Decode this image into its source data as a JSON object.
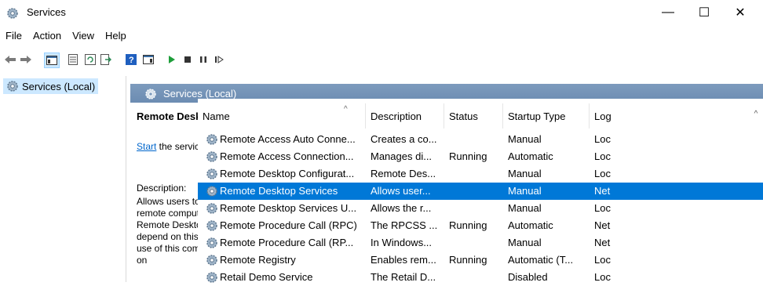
{
  "window": {
    "title": "Services",
    "minimize": "—",
    "maximize": "☐",
    "close": "✕"
  },
  "menu": [
    "File",
    "Action",
    "View",
    "Help"
  ],
  "tree": {
    "item": "Services (Local)"
  },
  "pane": {
    "header": "Services (Local)"
  },
  "details": {
    "name": "Remote Desktop Services",
    "start_link": "Start",
    "start_rest": " the service",
    "desc_label": "Description:",
    "desc_text": "Allows users to connect interactively to a remote computer. Remote Desktop and Remote Desktop Session Host Server depend on this service. To prevent remote use of this computer, clear the checkboxes on"
  },
  "columns": [
    "Name",
    "Description",
    "Status",
    "Startup Type",
    "Log"
  ],
  "rows": [
    {
      "name": "Remote Access Auto Conne...",
      "desc": "Creates a co...",
      "status": "",
      "startup": "Manual",
      "log": "Loc"
    },
    {
      "name": "Remote Access Connection...",
      "desc": "Manages di...",
      "status": "Running",
      "startup": "Automatic",
      "log": "Loc"
    },
    {
      "name": "Remote Desktop Configurat...",
      "desc": "Remote Des...",
      "status": "",
      "startup": "Manual",
      "log": "Loc"
    },
    {
      "name": "Remote Desktop Services",
      "desc": "Allows user...",
      "status": "",
      "startup": "Manual",
      "log": "Net",
      "selected": true
    },
    {
      "name": "Remote Desktop Services U...",
      "desc": "Allows the r...",
      "status": "",
      "startup": "Manual",
      "log": "Loc"
    },
    {
      "name": "Remote Procedure Call (RPC)",
      "desc": "The RPCSS ...",
      "status": "Running",
      "startup": "Automatic",
      "log": "Net"
    },
    {
      "name": "Remote Procedure Call (RP...",
      "desc": "In Windows...",
      "status": "",
      "startup": "Manual",
      "log": "Net"
    },
    {
      "name": "Remote Registry",
      "desc": "Enables rem...",
      "status": "Running",
      "startup": "Automatic (T...",
      "log": "Loc"
    },
    {
      "name": "Retail Demo Service",
      "desc": "The Retail D...",
      "status": "",
      "startup": "Disabled",
      "log": "Loc"
    }
  ]
}
